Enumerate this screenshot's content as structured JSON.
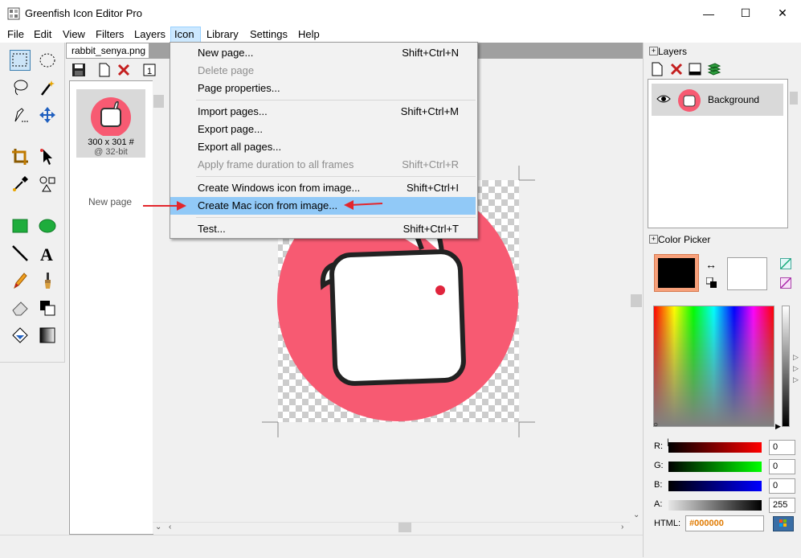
{
  "app": {
    "title": "Greenfish Icon Editor Pro"
  },
  "window_controls": {
    "minimize": "—",
    "maximize": "☐",
    "close": "✕"
  },
  "menubar": [
    "File",
    "Edit",
    "View",
    "Filters",
    "Layers",
    "Icon",
    "Library",
    "Settings",
    "Help"
  ],
  "document": {
    "tab_label": "rabbit_senya.png"
  },
  "page_list": {
    "thumb_size": "300 x 301 #",
    "thumb_depth": "@ 32-bit",
    "new_page_hint": "New page"
  },
  "icon_menu": {
    "items": [
      {
        "label": "New page...",
        "shortcut": "Shift+Ctrl+N",
        "enabled": true
      },
      {
        "label": "Delete page",
        "shortcut": "",
        "enabled": false
      },
      {
        "label": "Page properties...",
        "shortcut": "",
        "enabled": true
      },
      {
        "label": "Import pages...",
        "shortcut": "Shift+Ctrl+M",
        "enabled": true
      },
      {
        "label": "Export page...",
        "shortcut": "",
        "enabled": true
      },
      {
        "label": "Export all pages...",
        "shortcut": "",
        "enabled": true
      },
      {
        "label": "Apply frame duration to all frames",
        "shortcut": "Shift+Ctrl+R",
        "enabled": false
      },
      {
        "label": "Create Windows icon from image...",
        "shortcut": "Shift+Ctrl+I",
        "enabled": true
      },
      {
        "label": "Create Mac icon from image...",
        "shortcut": "",
        "enabled": true,
        "highlighted": true
      },
      {
        "label": "Test...",
        "shortcut": "Shift+Ctrl+T",
        "enabled": true
      }
    ]
  },
  "layers_panel": {
    "title": "Layers",
    "layers": [
      {
        "name": "Background",
        "visible": true
      }
    ]
  },
  "color_picker": {
    "title": "Color Picker",
    "primary": "#000000",
    "secondary": "#FFFFFF",
    "channels": [
      {
        "label": "R:",
        "value": "0"
      },
      {
        "label": "G:",
        "value": "0"
      },
      {
        "label": "B:",
        "value": "0"
      },
      {
        "label": "A:",
        "value": "255"
      }
    ],
    "html_label": "HTML:",
    "html_value": "#000000"
  },
  "colors": {
    "icon_red": "#f75a72",
    "menu_highlight": "#91c9f7",
    "arrow_red": "#e3262c",
    "hex_orange": "#e07a00"
  }
}
